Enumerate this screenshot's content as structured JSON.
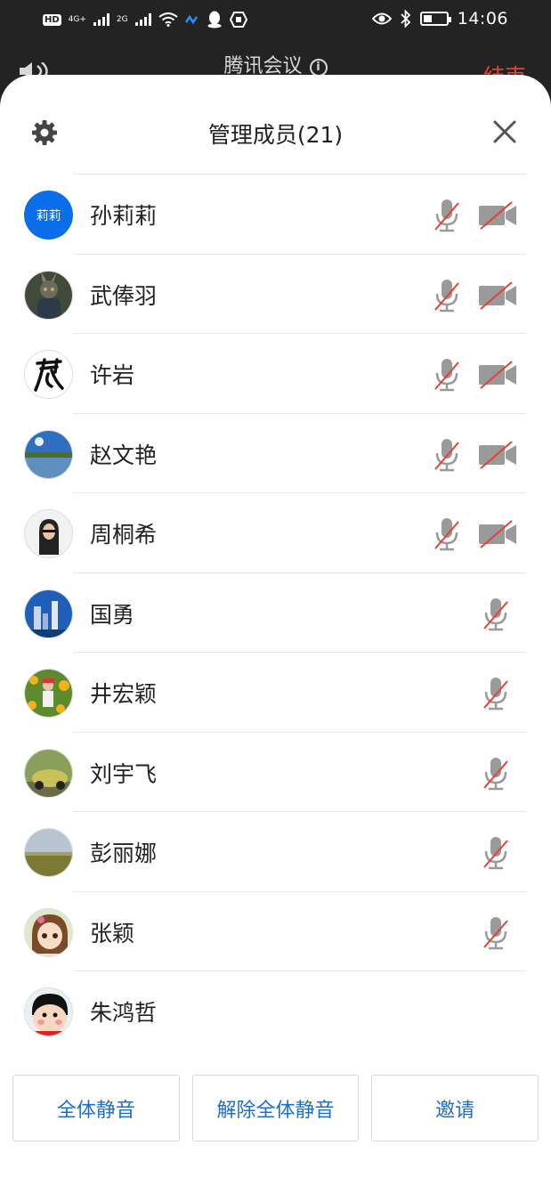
{
  "status_bar": {
    "hd": "HD",
    "net1": "4G+",
    "net2": "2G",
    "time": "14:06"
  },
  "header": {
    "meeting_title": "腾讯会议",
    "info": "i",
    "end_label": "结束"
  },
  "sheet": {
    "title": "管理成员(21)"
  },
  "members": [
    {
      "name": "孙莉莉",
      "avatar_text": "莉莉",
      "mic": "muted",
      "camera": "off"
    },
    {
      "name": "武俸羽",
      "mic": "muted",
      "camera": "off"
    },
    {
      "name": "许岩",
      "mic": "muted",
      "camera": "off"
    },
    {
      "name": "赵文艳",
      "mic": "muted",
      "camera": "off"
    },
    {
      "name": "周桐希",
      "mic": "muted",
      "camera": "off"
    },
    {
      "name": "国勇",
      "mic": "muted"
    },
    {
      "name": "井宏颖",
      "mic": "muted"
    },
    {
      "name": "刘宇飞",
      "mic": "muted"
    },
    {
      "name": "彭丽娜",
      "mic": "muted"
    },
    {
      "name": "张颖",
      "mic": "muted"
    },
    {
      "name": "朱鸿哲"
    }
  ],
  "actions": {
    "mute_all": "全体静音",
    "unmute_all": "解除全体静音",
    "invite": "邀请"
  },
  "colors": {
    "accent": "#1a6fd1",
    "avatar_blue": "#0a6ee8",
    "muted_slash": "#e8402f",
    "icon_gray": "#9a9a9a"
  }
}
